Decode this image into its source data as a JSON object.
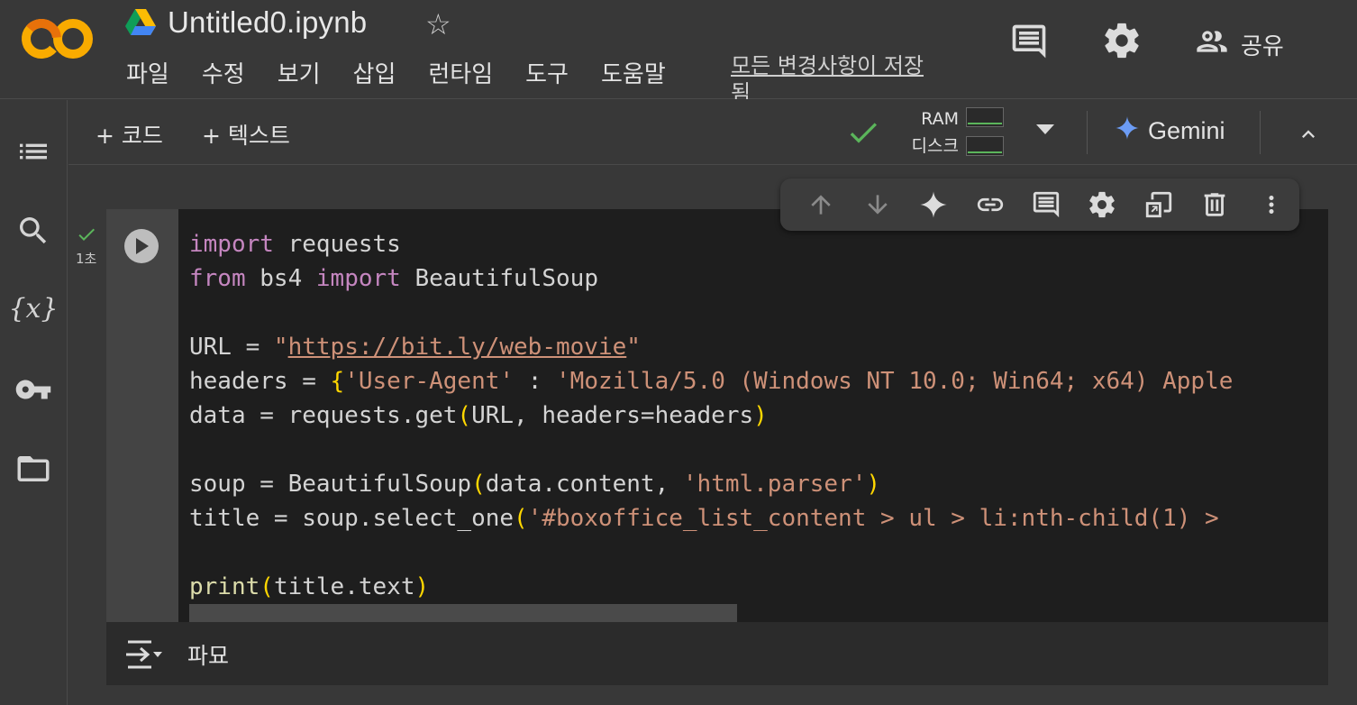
{
  "app": {
    "logo_text": "CO",
    "notebook_title": "Untitled0.ipynb",
    "menu": [
      "파일",
      "수정",
      "보기",
      "삽입",
      "런타임",
      "도구",
      "도움말"
    ],
    "save_status": "모든 변경사항이 저장됨",
    "share_label": "공유"
  },
  "toolbar": {
    "add_code": "+ 코드",
    "add_text": "+ 텍스트",
    "ram_label": "RAM",
    "disk_label": "디스크",
    "gemini_label": "Gemini"
  },
  "cell": {
    "exec_time": "1초",
    "code_lines": [
      "import requests",
      "from bs4 import BeautifulSoup",
      "",
      "URL = \"https://bit.ly/web-movie\"",
      "headers = {'User-Agent' : 'Mozilla/5.0 (Windows NT 10.0; Win64; x64) Apple",
      "data = requests.get(URL, headers=headers)",
      "",
      "soup = BeautifulSoup(data.content, 'html.parser')",
      "title = soup.select_one('#boxoffice_list_content > ul > li:nth-child(1) >",
      "",
      "print(title.text)"
    ],
    "output_text": "파묘"
  },
  "colors": {
    "keyword": "#c586c0",
    "string": "#ce9178",
    "function": "#dcdcaa",
    "bracket": "#ffd700",
    "success": "#5bb55b"
  },
  "icons": {
    "sidebar": [
      "table-of-contents-icon",
      "search-icon",
      "variables-icon",
      "key-icon",
      "folder-icon"
    ],
    "cell_toolbar": [
      "arrow-up-icon",
      "arrow-down-icon",
      "sparkle-icon",
      "link-icon",
      "comment-icon",
      "gear-icon",
      "mirror-cell-icon",
      "delete-icon",
      "more-vert-icon"
    ]
  }
}
